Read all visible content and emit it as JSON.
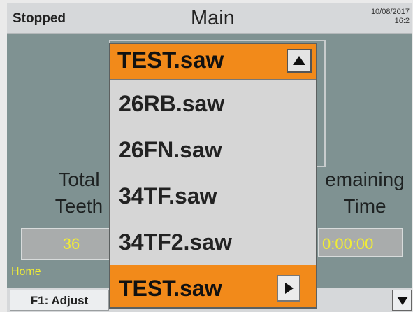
{
  "header": {
    "status": "Stopped",
    "title": "Main",
    "date": "10/08/2017",
    "time": "16:2"
  },
  "main": {
    "total_teeth_label_line1": "Total",
    "total_teeth_label_line2": "Teeth",
    "total_teeth_value": "36",
    "remaining_time_label_line1": "emaining",
    "remaining_time_label_line2": "Time",
    "remaining_time_value": "0:00:00",
    "home_label": "Home"
  },
  "footer": {
    "f1_label": "F1: Adjust"
  },
  "dropdown": {
    "selected": "TEST.saw",
    "items": [
      "26RB.saw",
      "26FN.saw",
      "34TF.saw",
      "34TF2.saw",
      "TEST.saw"
    ],
    "highlighted_index": 4
  },
  "colors": {
    "accent": "#f28a1a",
    "background": "#7f9292",
    "value_text": "#f0ec36"
  }
}
